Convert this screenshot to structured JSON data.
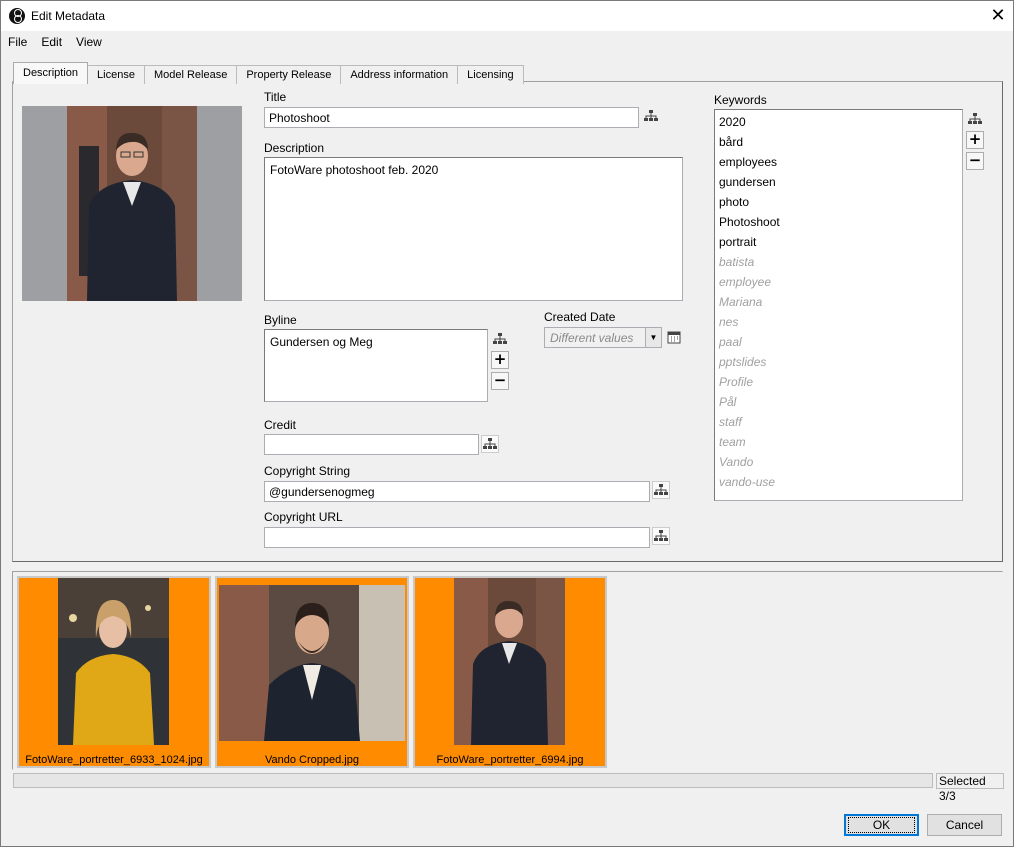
{
  "window": {
    "title": "Edit Metadata"
  },
  "menu": [
    "File",
    "Edit",
    "View"
  ],
  "tabs": [
    "Description",
    "License",
    "Model Release",
    "Property Release",
    "Address information",
    "Licensing"
  ],
  "fields": {
    "title": {
      "label": "Title",
      "value": "Photoshoot"
    },
    "description": {
      "label": "Description",
      "value": "FotoWare photoshoot feb. 2020"
    },
    "byline": {
      "label": "Byline",
      "value": "Gundersen og Meg"
    },
    "created_date": {
      "label": "Created Date",
      "value": "Different values"
    },
    "credit": {
      "label": "Credit",
      "value": ""
    },
    "copyright_string": {
      "label": "Copyright String",
      "value": "@gundersenogmeg"
    },
    "copyright_url": {
      "label": "Copyright URL",
      "value": ""
    }
  },
  "keywords": {
    "label": "Keywords",
    "common": [
      "2020",
      "bård",
      "employees",
      "gundersen",
      "photo",
      "Photoshoot",
      "portrait"
    ],
    "partial": [
      "batista",
      "employee",
      "Mariana",
      "nes",
      "paal",
      "pptslides",
      "Profile",
      "Pål",
      "staff",
      "team",
      "Vando",
      "vando-use"
    ]
  },
  "thumbnails": [
    {
      "filename": "FotoWare_portretter_6933_1024.jpg"
    },
    {
      "filename": "Vando Cropped.jpg"
    },
    {
      "filename": "FotoWare_portretter_6994.jpg"
    }
  ],
  "status": "Selected 3/3",
  "buttons": {
    "ok": "OK",
    "cancel": "Cancel"
  },
  "colors": {
    "selection": "#ff8c00",
    "accent": "#0078d7"
  }
}
